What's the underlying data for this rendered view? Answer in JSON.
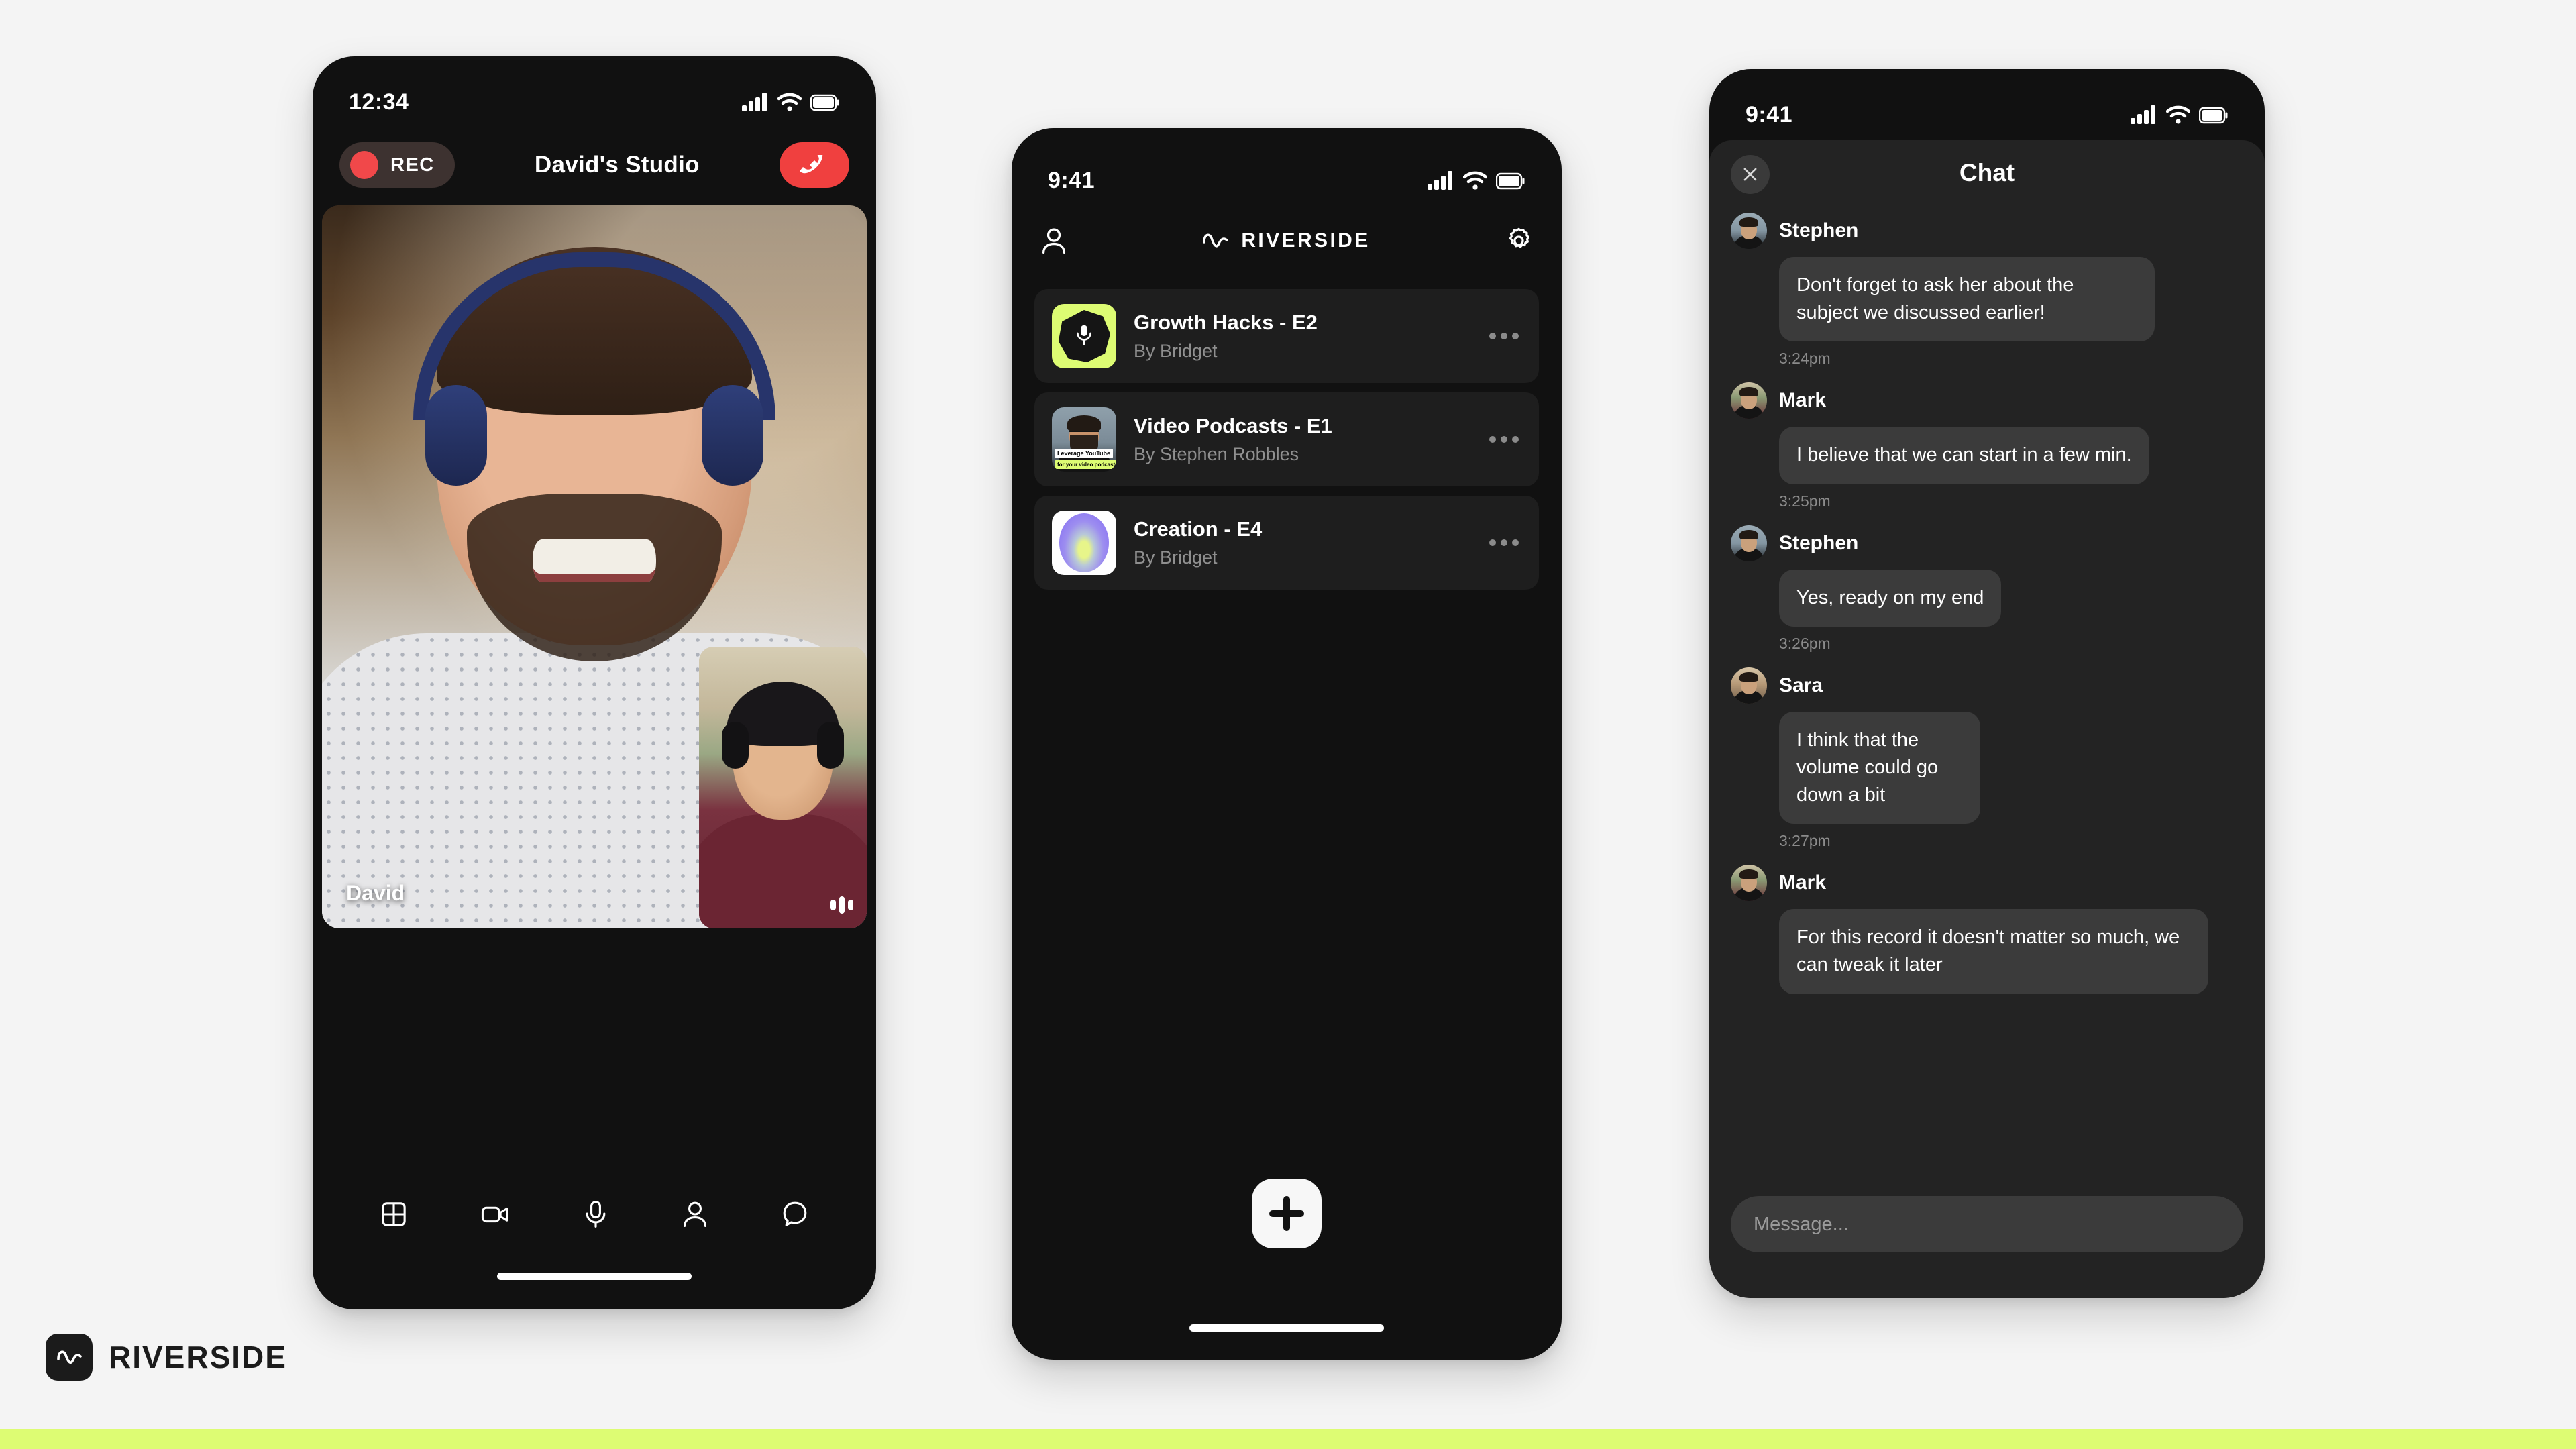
{
  "brand": {
    "name": "RIVERSIDE",
    "mark_icon": "waveform-icon",
    "accent_green": "#ddfc73",
    "dark": "#111111"
  },
  "studio_phone": {
    "status": {
      "time": "12:34",
      "signal_icon": "cellular-signal-icon",
      "wifi_icon": "wifi-icon",
      "battery_icon": "battery-icon"
    },
    "topbar": {
      "rec_label": "REC",
      "rec_dot_icon": "record-dot-icon",
      "title": "David's Studio",
      "hangup_icon": "hangup-phone-icon",
      "hangup_color": "#f0403f"
    },
    "video": {
      "main_name": "David",
      "pip_audio_icon": "audio-levels-icon"
    },
    "toolbar": [
      {
        "icon": "grid-layout-icon",
        "label": "Layout"
      },
      {
        "icon": "video-camera-icon",
        "label": "Camera"
      },
      {
        "icon": "microphone-icon",
        "label": "Microphone"
      },
      {
        "icon": "person-icon",
        "label": "Participants"
      },
      {
        "icon": "chat-bubble-icon",
        "label": "Chat"
      }
    ]
  },
  "library_phone": {
    "status": {
      "time": "9:41",
      "signal_icon": "cellular-signal-icon",
      "wifi_icon": "wifi-icon",
      "battery_icon": "battery-icon"
    },
    "header": {
      "profile_icon": "person-icon",
      "logo_icon": "waveform-icon",
      "logo_text": "RIVERSIDE",
      "settings_icon": "gear-icon"
    },
    "recordings": [
      {
        "title": "Growth Hacks - E2",
        "author": "By Bridget",
        "thumb": "mic-green-thumb",
        "more_icon": "more-horizontal-icon"
      },
      {
        "title": "Video Podcasts - E1",
        "author": "By Stephen Robbles",
        "thumb": "photo-thumb",
        "caption_line1": "Leverage YouTube",
        "caption_line2": "for your video podcast",
        "more_icon": "more-horizontal-icon"
      },
      {
        "title": "Creation - E4",
        "author": "By Bridget",
        "thumb": "orb-thumb",
        "more_icon": "more-horizontal-icon"
      }
    ],
    "fab": {
      "icon": "plus-icon",
      "label": "New recording"
    }
  },
  "chat_phone": {
    "status": {
      "time": "9:41",
      "signal_icon": "cellular-signal-icon",
      "wifi_icon": "wifi-icon",
      "battery_icon": "battery-icon"
    },
    "header": {
      "close_icon": "close-x-icon",
      "title": "Chat"
    },
    "messages": [
      {
        "author": "Stephen",
        "avatar": "stephen-avatar",
        "text": "Don't forget to ask her about the subject we discussed earlier!",
        "time": "3:24pm",
        "wide": false
      },
      {
        "author": "Mark",
        "avatar": "mark-avatar",
        "text": "I believe that we can start in a few min.",
        "time": "3:25pm",
        "wide": true
      },
      {
        "author": "Stephen",
        "avatar": "stephen-avatar",
        "text": "Yes, ready on my end",
        "time": "3:26pm",
        "wide": true
      },
      {
        "author": "Sara",
        "avatar": "sara-avatar",
        "text": "I think that the volume could go down a bit",
        "time": "3:27pm",
        "wide": false
      },
      {
        "author": "Mark",
        "avatar": "mark-avatar",
        "text": "For this record it doesn't matter so much, we can tweak it later",
        "time": "",
        "wide": true
      }
    ],
    "composer": {
      "placeholder": "Message..."
    }
  }
}
